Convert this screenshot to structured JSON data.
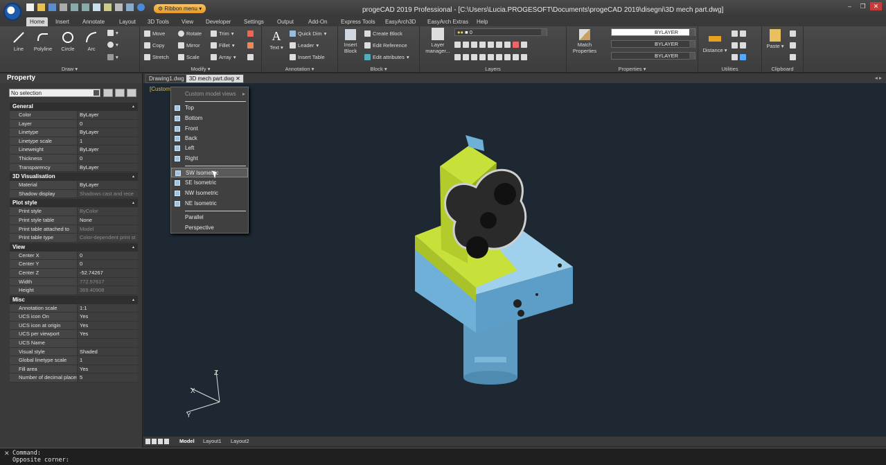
{
  "title": "progeCAD 2019 Professional - [C:\\Users\\Lucia.PROGESOFT\\Documents\\progeCAD 2019\\disegni\\3D mech part.dwg]",
  "ribbon_menu_label": "Ribbon menu",
  "tabs": [
    "Home",
    "Insert",
    "Annotate",
    "Layout",
    "3D Tools",
    "View",
    "Developer",
    "Settings",
    "Output",
    "Add-On",
    "Express Tools",
    "EasyArch3D",
    "EasyArch Extras",
    "Help"
  ],
  "ribbon": {
    "draw": {
      "title": "Draw",
      "line": "Line",
      "polyline": "Polyline",
      "circle": "Circle",
      "arc": "Arc"
    },
    "modify": {
      "title": "Modify",
      "move": "Move",
      "rotate": "Rotate",
      "trim": "Trim",
      "copy": "Copy",
      "mirror": "Mirror",
      "fillet": "Fillet",
      "stretch": "Stretch",
      "scale": "Scale",
      "array": "Array"
    },
    "annotation": {
      "title": "Annotation",
      "text": "Text",
      "quick_dim": "Quick Dim",
      "leader": "Leader",
      "insert_table": "Insert Table"
    },
    "block": {
      "title": "Block",
      "insert": "Insert Block",
      "create": "Create Block",
      "edit_ref": "Edit Reference",
      "edit_attr": "Edit attributes"
    },
    "layers": {
      "title": "Layers",
      "manager": "Layer manager...",
      "current": "0"
    },
    "properties": {
      "title": "Properties",
      "match": "Match Properties",
      "color": "BYLAYER",
      "linetype": "BYLAYER",
      "lineweight": "BYLAYER"
    },
    "utilities": {
      "title": "Utilities",
      "distance": "Distance"
    },
    "clipboard": {
      "title": "Clipboard",
      "paste": "Paste"
    }
  },
  "property_panel": {
    "title": "Property",
    "selection": "No selection",
    "sections": [
      {
        "name": "General",
        "rows": [
          [
            "Color",
            "ByLayer"
          ],
          [
            "Layer",
            "0"
          ],
          [
            "Linetype",
            "ByLayer"
          ],
          [
            "Linetype scale",
            "1"
          ],
          [
            "Lineweight",
            "ByLayer"
          ],
          [
            "Thickness",
            "0"
          ],
          [
            "Transparency",
            "ByLayer"
          ]
        ]
      },
      {
        "name": "3D Visualisation",
        "rows": [
          [
            "Material",
            "ByLayer"
          ],
          [
            "Shadow display",
            "Shadows cast and rece"
          ]
        ]
      },
      {
        "name": "Plot style",
        "rows": [
          [
            "Print style",
            "ByColor"
          ],
          [
            "Print style table",
            "None"
          ],
          [
            "Print table attached to",
            "Model"
          ],
          [
            "Print table type",
            "Color-dependent print st"
          ]
        ]
      },
      {
        "name": "View",
        "rows": [
          [
            "Center X",
            "0"
          ],
          [
            "Center Y",
            "0"
          ],
          [
            "Center Z",
            "-52.74267"
          ],
          [
            "Width",
            "772.57617"
          ],
          [
            "Height",
            "369.40908"
          ]
        ]
      },
      {
        "name": "Misc",
        "rows": [
          [
            "Annotation scale",
            "1:1"
          ],
          [
            "UCS icon On",
            "Yes"
          ],
          [
            "UCS icon at origin",
            "Yes"
          ],
          [
            "UCS per viewport",
            "Yes"
          ],
          [
            "UCS Name",
            ""
          ],
          [
            "Visual style",
            "Shaded"
          ],
          [
            "Global linetype scale",
            "1"
          ],
          [
            "Fill area",
            "Yes"
          ],
          [
            "Number of decimal places",
            "5"
          ]
        ]
      }
    ]
  },
  "doc_tabs": [
    "Drawing1.dwg",
    "3D mech part.dwg"
  ],
  "view_label": "[Custom",
  "context_menu": {
    "header": "Custom model views",
    "views": [
      "Top",
      "Bottom",
      "Front",
      "Back",
      "Left",
      "Right"
    ],
    "isometric": [
      "SW Isometric",
      "SE Isometric",
      "NW Isometric",
      "NE Isometric"
    ],
    "projection": [
      "Parallel",
      "Perspective"
    ]
  },
  "layout_tabs": [
    "Model",
    "Layout1",
    "Layout2"
  ],
  "command_lines": [
    "Command:",
    "Opposite corner:"
  ],
  "colors": {
    "accent": "#d6d6d6",
    "canvas": "#1e2833",
    "green": "#b8d326",
    "blue": "#6fb0d8"
  }
}
